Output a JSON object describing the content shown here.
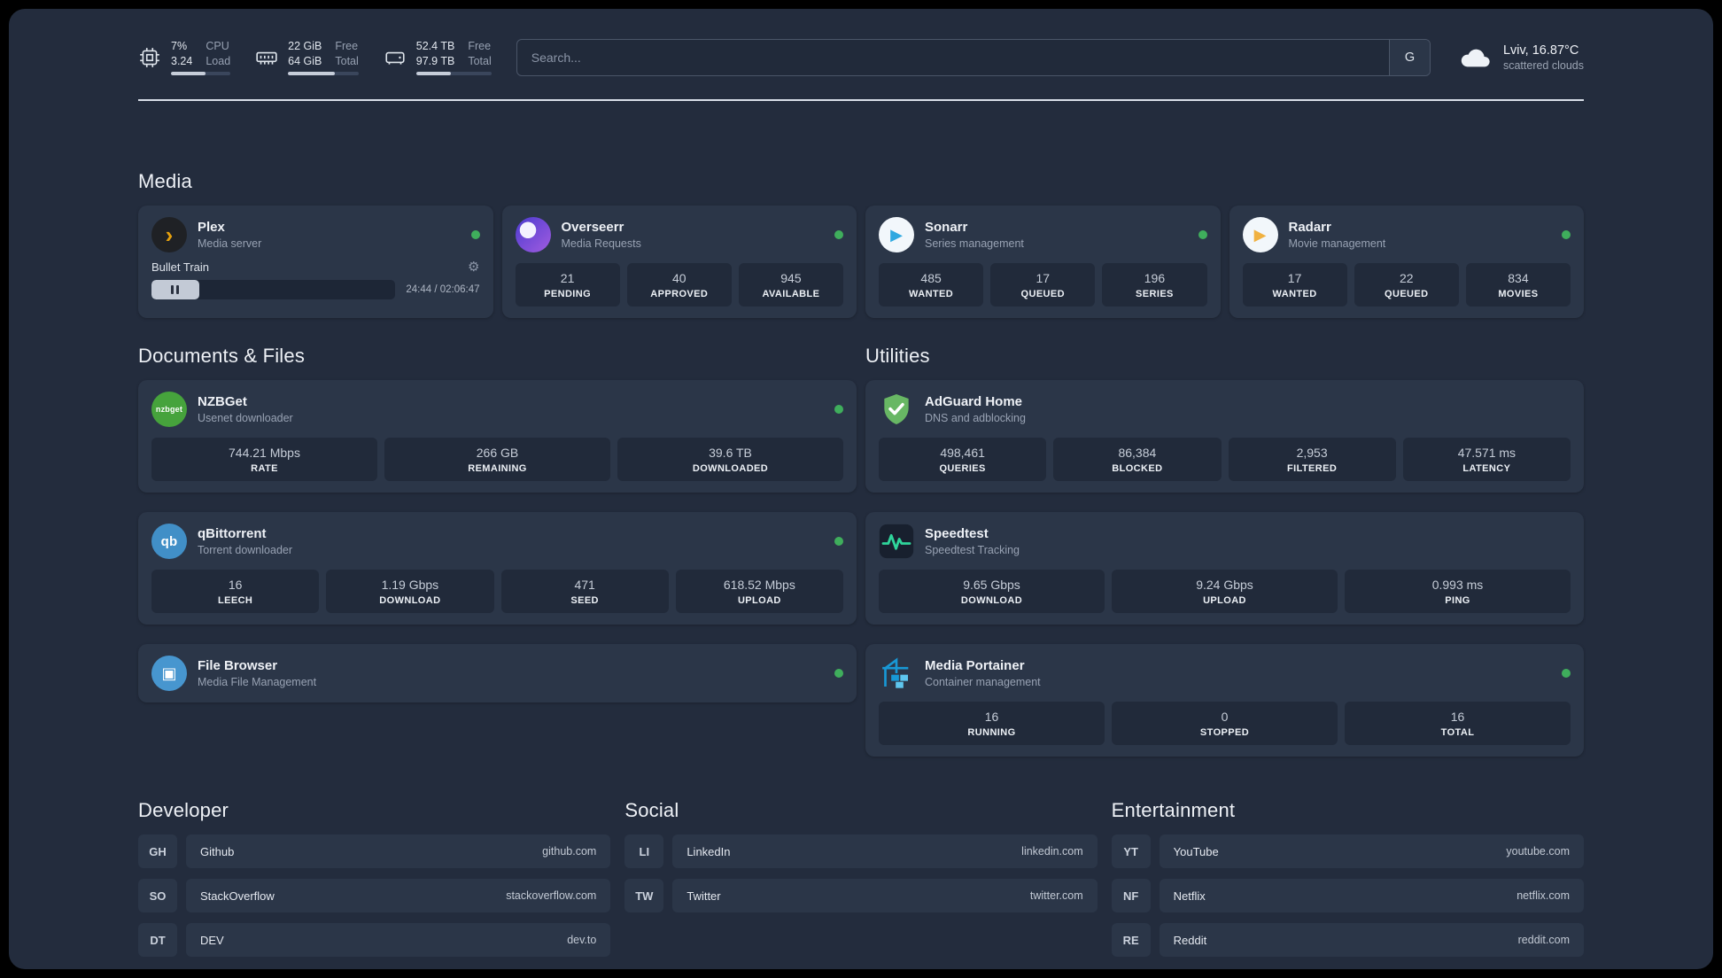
{
  "topbar": {
    "cpu": {
      "value1": "7%",
      "value2": "3.24",
      "label1": "CPU",
      "label2": "Load",
      "progress_percent": 58,
      "icon": "cpu-icon"
    },
    "ram": {
      "value1": "22 GiB",
      "value2": "64 GiB",
      "label1": "Free",
      "label2": "Total",
      "progress_percent": 66,
      "icon": "ram-icon"
    },
    "disk": {
      "value1": "52.4 TB",
      "value2": "97.9 TB",
      "label1": "Free",
      "label2": "Total",
      "progress_percent": 46,
      "icon": "hard-drive-icon"
    },
    "search": {
      "placeholder": "Search...",
      "button_label": "G"
    },
    "weather": {
      "location": "Lviv, 16.87°C",
      "condition": "scattered clouds",
      "icon": "cloud-icon"
    }
  },
  "colors": {
    "background": "#232c3d",
    "card": "#2b3648",
    "tile": "#212a3a",
    "online_green": "#3fae5c"
  },
  "media_section": {
    "title": "Media",
    "services": [
      {
        "name": "Plex",
        "subtitle": "Media server",
        "online": true,
        "icon": {
          "name": "plex-icon",
          "kind": "circle",
          "bg": "#1f2125",
          "fg": "#e5a00d",
          "glyph": "›",
          "size": "26px"
        },
        "player": {
          "title": "Bullet Train",
          "time": "24:44 / 02:06:47",
          "progress_percent": 19.6
        }
      },
      {
        "name": "Overseerr",
        "subtitle": "Media Requests",
        "online": true,
        "icon": {
          "name": "overseerr-icon",
          "kind": "overseerr",
          "bg1": "#4c3bcf",
          "bg2": "#a15ce0"
        },
        "stats": [
          {
            "value": "21",
            "label": "PENDING"
          },
          {
            "value": "40",
            "label": "APPROVED"
          },
          {
            "value": "945",
            "label": "AVAILABLE"
          }
        ]
      },
      {
        "name": "Sonarr",
        "subtitle": "Series management",
        "online": true,
        "icon": {
          "name": "sonarr-icon",
          "kind": "circle",
          "bg": "#f2f7fb",
          "fg": "#2ea8e0",
          "glyph": "▶",
          "size": "18px"
        },
        "stats": [
          {
            "value": "485",
            "label": "WANTED"
          },
          {
            "value": "17",
            "label": "QUEUED"
          },
          {
            "value": "196",
            "label": "SERIES"
          }
        ]
      },
      {
        "name": "Radarr",
        "subtitle": "Movie management",
        "online": true,
        "icon": {
          "name": "radarr-icon",
          "kind": "circle",
          "bg": "#f2f7fb",
          "fg": "#f0b141",
          "glyph": "▶",
          "size": "18px"
        },
        "stats": [
          {
            "value": "17",
            "label": "WANTED"
          },
          {
            "value": "22",
            "label": "QUEUED"
          },
          {
            "value": "834",
            "label": "MOVIES"
          }
        ]
      }
    ]
  },
  "left_section": {
    "title": "Documents & Files",
    "services": [
      {
        "name": "NZBGet",
        "subtitle": "Usenet downloader",
        "online": true,
        "icon": {
          "name": "nzbget-icon",
          "kind": "circle-text",
          "bg": "#46a33c",
          "fg": "#ffffff",
          "text": "nzbget",
          "size": "9px"
        },
        "stats": [
          {
            "value": "744.21 Mbps",
            "label": "RATE"
          },
          {
            "value": "266 GB",
            "label": "REMAINING"
          },
          {
            "value": "39.6 TB",
            "label": "DOWNLOADED"
          }
        ]
      },
      {
        "name": "qBittorrent",
        "subtitle": "Torrent downloader",
        "online": true,
        "icon": {
          "name": "qbittorrent-icon",
          "kind": "circle-text",
          "bg": "#418fc7",
          "fg": "#ffffff",
          "text": "qb",
          "size": "15px"
        },
        "stats": [
          {
            "value": "16",
            "label": "LEECH"
          },
          {
            "value": "1.19 Gbps",
            "label": "DOWNLOAD"
          },
          {
            "value": "471",
            "label": "SEED"
          },
          {
            "value": "618.52 Mbps",
            "label": "UPLOAD"
          }
        ]
      },
      {
        "name": "File Browser",
        "subtitle": "Media File Management",
        "online": true,
        "icon": {
          "name": "filebrowser-icon",
          "kind": "circle",
          "bg": "#4796cf",
          "fg": "#ffffff",
          "glyph": "▣",
          "size": "18px"
        }
      }
    ]
  },
  "right_section": {
    "title": "Utilities",
    "services": [
      {
        "name": "AdGuard Home",
        "subtitle": "DNS and adblocking",
        "online": null,
        "icon": {
          "name": "adguard-shield-icon",
          "kind": "shield",
          "bg": "#68b764"
        },
        "stats": [
          {
            "value": "498,461",
            "label": "QUERIES"
          },
          {
            "value": "86,384",
            "label": "BLOCKED"
          },
          {
            "value": "2,953",
            "label": "FILTERED"
          },
          {
            "value": "47.571 ms",
            "label": "LATENCY"
          }
        ]
      },
      {
        "name": "Speedtest",
        "subtitle": "Speedtest Tracking",
        "online": null,
        "icon": {
          "name": "speedtest-wave-icon",
          "kind": "wave",
          "bg": "#18202e",
          "fg": "#2fd59b"
        },
        "stats": [
          {
            "value": "9.65 Gbps",
            "label": "DOWNLOAD"
          },
          {
            "value": "9.24 Gbps",
            "label": "UPLOAD"
          },
          {
            "value": "0.993 ms",
            "label": "PING"
          }
        ]
      },
      {
        "name": "Media Portainer",
        "subtitle": "Container management",
        "online": true,
        "icon": {
          "name": "portainer-crane-icon",
          "kind": "crane",
          "fg": "#1898d5",
          "fg2": "#5ec6ee"
        },
        "stats": [
          {
            "value": "16",
            "label": "RUNNING"
          },
          {
            "value": "0",
            "label": "STOPPED"
          },
          {
            "value": "16",
            "label": "TOTAL"
          }
        ]
      }
    ]
  },
  "bookmark_sections": [
    {
      "title": "Developer",
      "links": [
        {
          "abbr": "GH",
          "name": "Github",
          "url": "github.com"
        },
        {
          "abbr": "SO",
          "name": "StackOverflow",
          "url": "stackoverflow.com"
        },
        {
          "abbr": "DT",
          "name": "DEV",
          "url": "dev.to"
        }
      ]
    },
    {
      "title": "Social",
      "links": [
        {
          "abbr": "LI",
          "name": "LinkedIn",
          "url": "linkedin.com"
        },
        {
          "abbr": "TW",
          "name": "Twitter",
          "url": "twitter.com"
        }
      ]
    },
    {
      "title": "Entertainment",
      "links": [
        {
          "abbr": "YT",
          "name": "YouTube",
          "url": "youtube.com"
        },
        {
          "abbr": "NF",
          "name": "Netflix",
          "url": "netflix.com"
        },
        {
          "abbr": "RE",
          "name": "Reddit",
          "url": "reddit.com"
        }
      ]
    }
  ]
}
